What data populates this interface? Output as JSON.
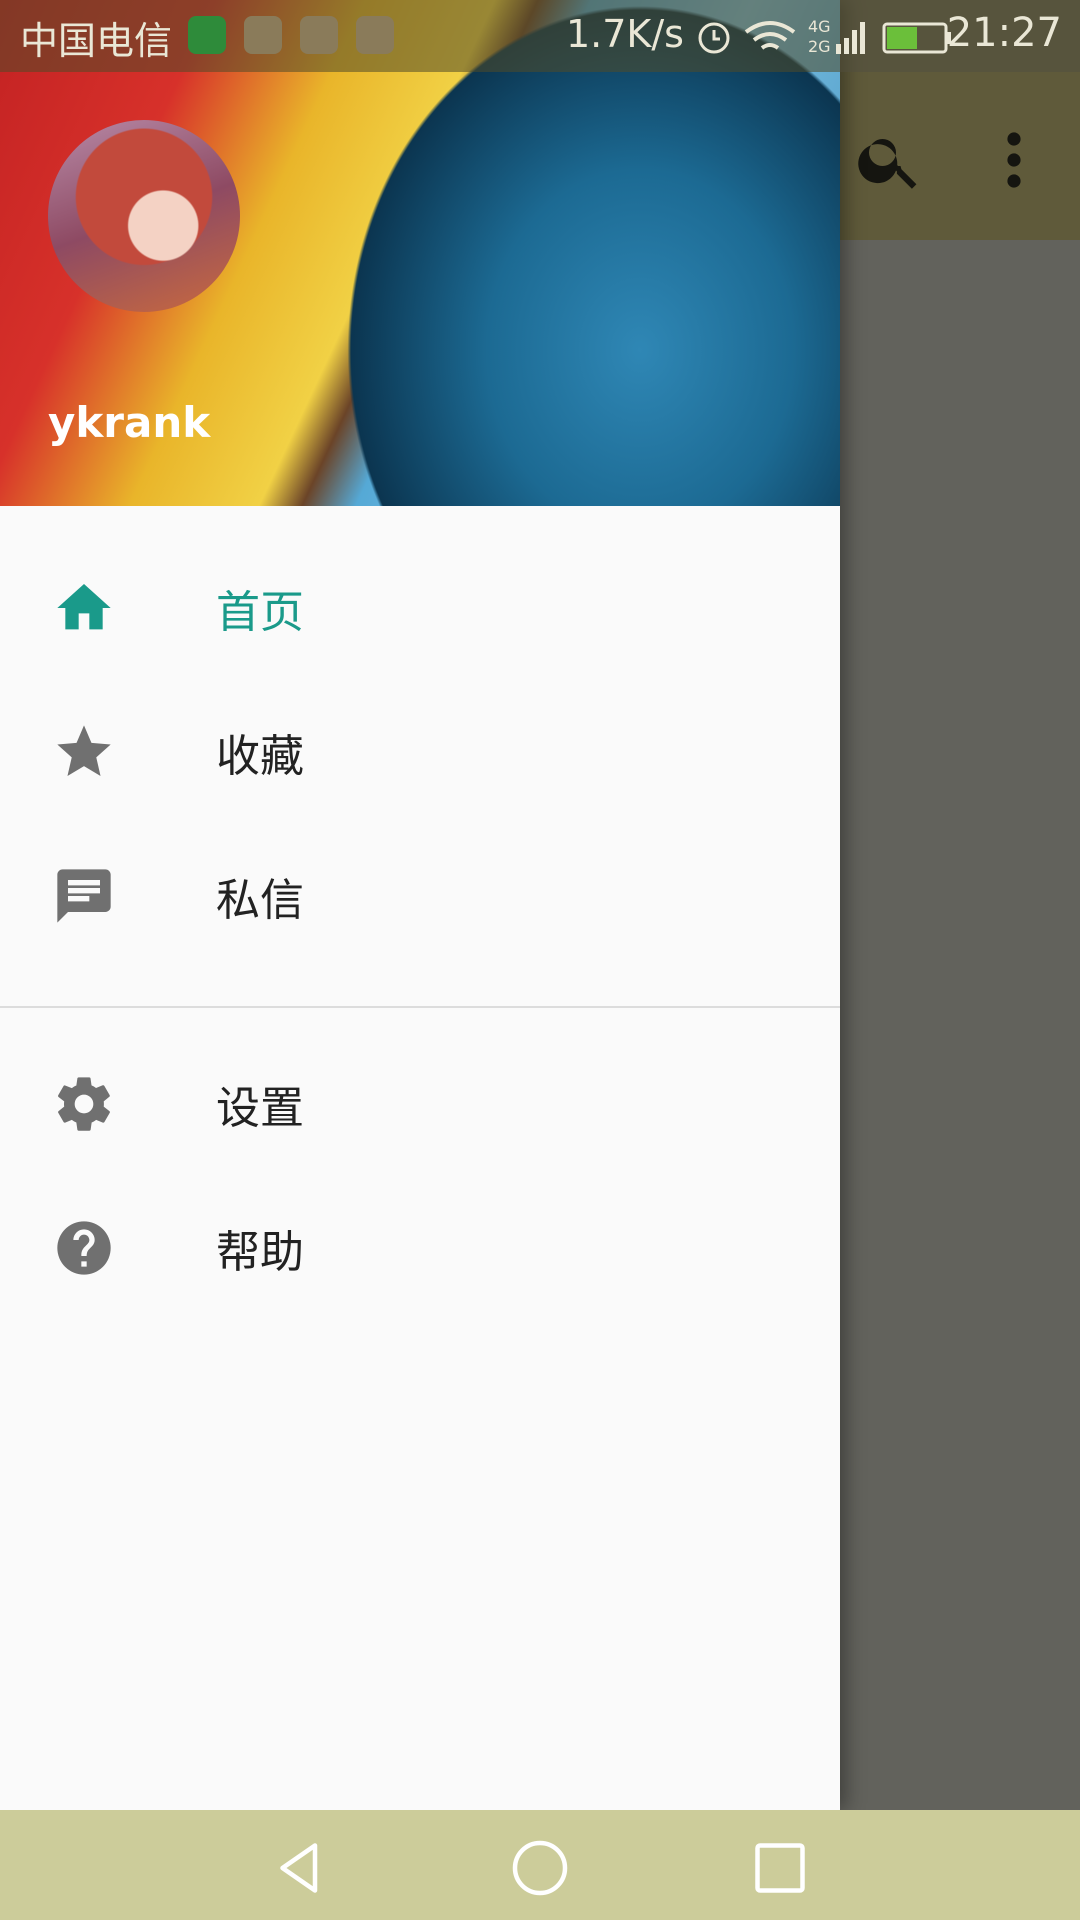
{
  "status_bar": {
    "carrier": "中国电信",
    "network_speed": "1.7K/s",
    "network_type": "4G 2G",
    "time": "21:27",
    "notification_icons": [
      "leaf-app-icon",
      "health-app-icon",
      "usb-icon",
      "settings-app-icon"
    ]
  },
  "drawer": {
    "username": "ykrank",
    "items": [
      {
        "label": "首页",
        "icon": "home-icon",
        "active": true
      },
      {
        "label": "收藏",
        "icon": "star-icon",
        "active": false
      },
      {
        "label": "私信",
        "icon": "message-icon",
        "active": false
      }
    ],
    "secondary_items": [
      {
        "label": "设置",
        "icon": "gear-icon"
      },
      {
        "label": "帮助",
        "icon": "help-icon"
      }
    ]
  },
  "colors": {
    "accent": "#1a9a8a",
    "icon_gray": "#707070",
    "nav_bar": "#cccc9a"
  }
}
